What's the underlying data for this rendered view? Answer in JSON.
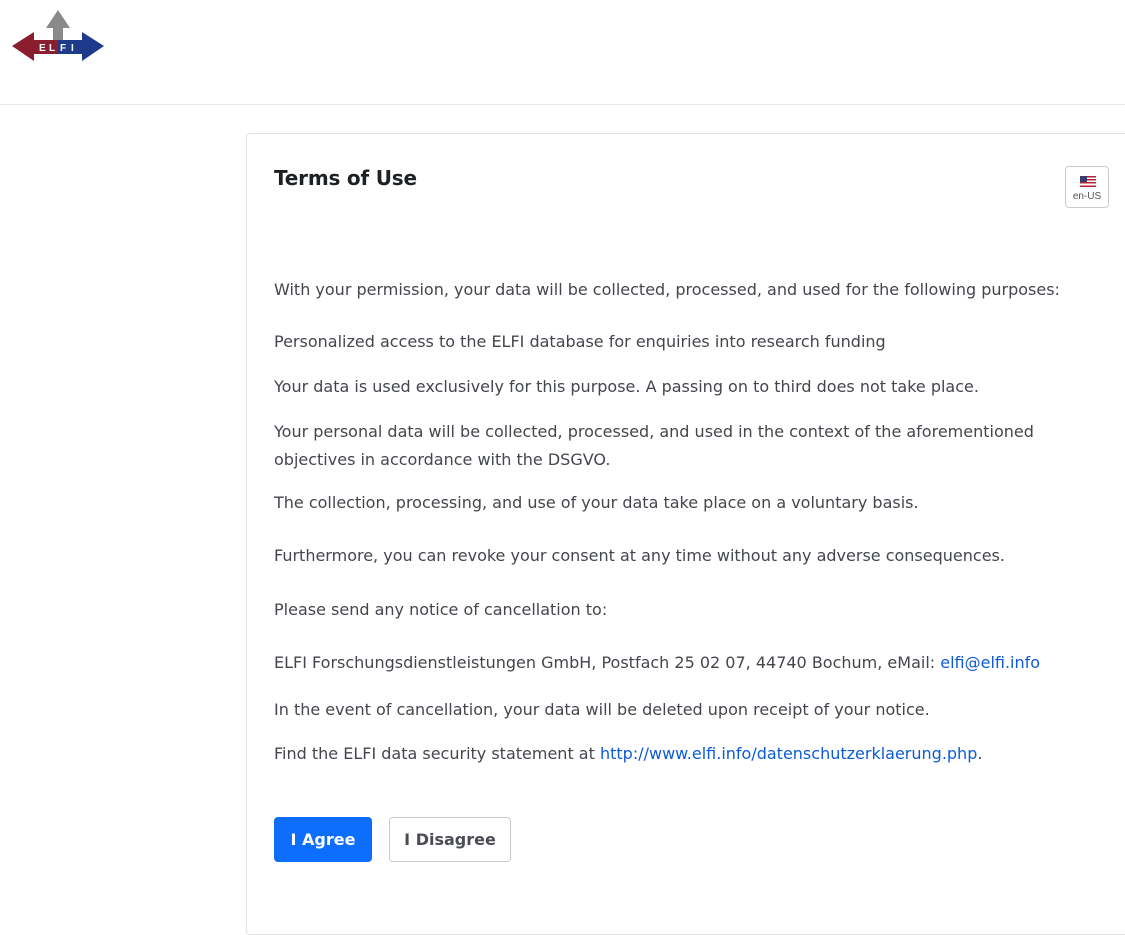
{
  "header": {
    "logo_text": "ELFI",
    "colors": {
      "left_arrow": "#8b1e2e",
      "right_arrow": "#1e3a8a",
      "up_arrow": "#8a8a8a"
    }
  },
  "terms": {
    "title": "Terms of Use",
    "language": {
      "code": "en-US",
      "icon": "us-flag-icon"
    },
    "paragraphs": {
      "p1": "With your permission, your data will be collected, processed, and used for the following purposes:",
      "p2": "Personalized access to the ELFI database for enquiries into research funding",
      "p3": "Your data is used exclusively for this purpose. A passing on to third does not take place.",
      "p4": "Your personal data will be collected, processed, and used in the context of the aforementioned objectives in accordance with the DSGVO.",
      "p5": "The collection, processing, and use of your data take place on a voluntary basis.",
      "p6": "Furthermore, you can revoke your consent at any time without any adverse consequences.",
      "p7": "Please send any notice of cancellation to:",
      "p8_text": "ELFI Forschungsdienstleistungen GmbH, Postfach 25 02 07, 44740 Bochum, eMail: ",
      "p8_link": "elfi@elfi.info",
      "p9": "In the event of cancellation, your data will be deleted upon receipt of your notice.",
      "p10_text": "Find the ELFI data security statement at ",
      "p10_link": "http://www.elfi.info/datenschutzerklaerung.php",
      "p10_end": "."
    },
    "buttons": {
      "agree": "I Agree",
      "disagree": "I Disagree"
    },
    "colors": {
      "primary": "#0d6efd",
      "link": "#0d5bd8"
    }
  }
}
